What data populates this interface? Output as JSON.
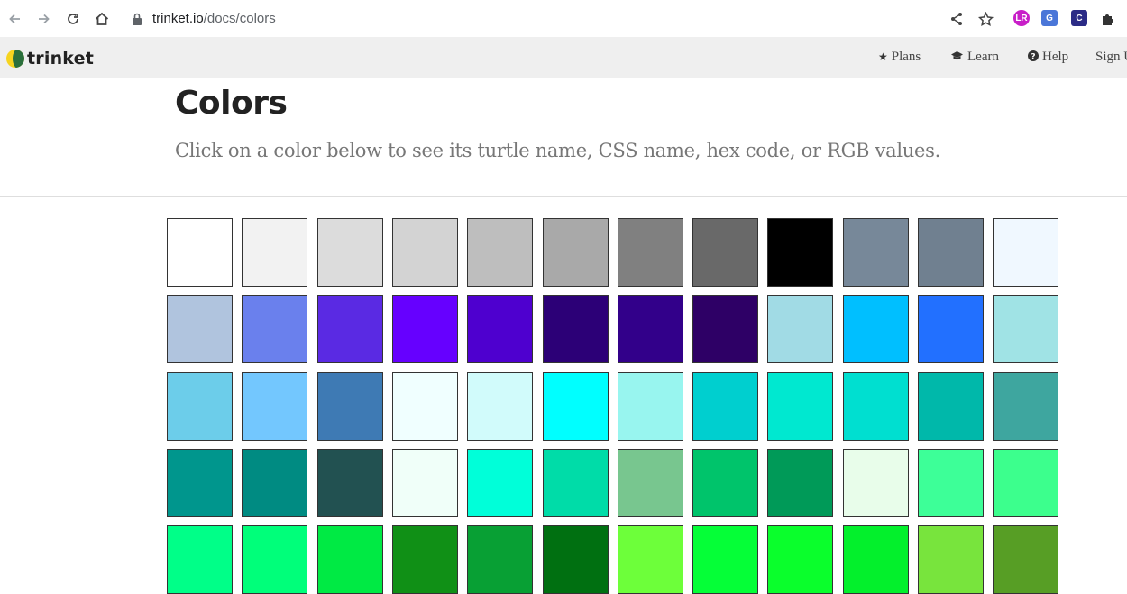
{
  "browser": {
    "url_host": "trinket.io",
    "url_path": "/docs/colors"
  },
  "site": {
    "logo_text": "trinket",
    "nav": [
      {
        "label": "Plans",
        "icon": "star-icon"
      },
      {
        "label": "Learn",
        "icon": "graduation-cap-icon"
      },
      {
        "label": "Help",
        "icon": "question-circle-icon"
      },
      {
        "label": "Sign U",
        "icon": ""
      }
    ]
  },
  "page": {
    "title": "Colors",
    "subtitle": "Click on a color below to see its turtle name, CSS name, hex code, or RGB values."
  },
  "swatch_rows": [
    [
      "#ffffff",
      "#f2f2f2",
      "#dcdcdc",
      "#d3d3d3",
      "#bebebe",
      "#a9a9a9",
      "#808080",
      "#696969",
      "#000000",
      "#778899",
      "#708090",
      "#f0f8ff"
    ],
    [
      "#b0c4de",
      "#6a80ed",
      "#5a2ae3",
      "#6600ff",
      "#4e00cf",
      "#2c0077",
      "#32008a",
      "#2e0066",
      "#a1dbe5",
      "#00bfff",
      "#2270ff",
      "#a0e3e5"
    ],
    [
      "#6ccdea",
      "#73c7fe",
      "#3e7ab4",
      "#f0ffff",
      "#d1fbfb",
      "#00ffff",
      "#98f5ef",
      "#00cfcf",
      "#00e8d0",
      "#00dfd0",
      "#00b8aa",
      "#3ea69f"
    ],
    [
      "#00968d",
      "#008b82",
      "#225151",
      "#f0fff9",
      "#00ffd9",
      "#00dca8",
      "#78c68f",
      "#00c46b",
      "#009a58",
      "#e8fdea",
      "#3dff98",
      "#3cff8d"
    ],
    [
      "#00ff88",
      "#00ff7a",
      "#00ea44",
      "#109016",
      "#08a034",
      "#007011",
      "#6dff3a",
      "#05ff37",
      "#0aff2c",
      "#03f02c",
      "#78e43d",
      "#579e25"
    ]
  ]
}
